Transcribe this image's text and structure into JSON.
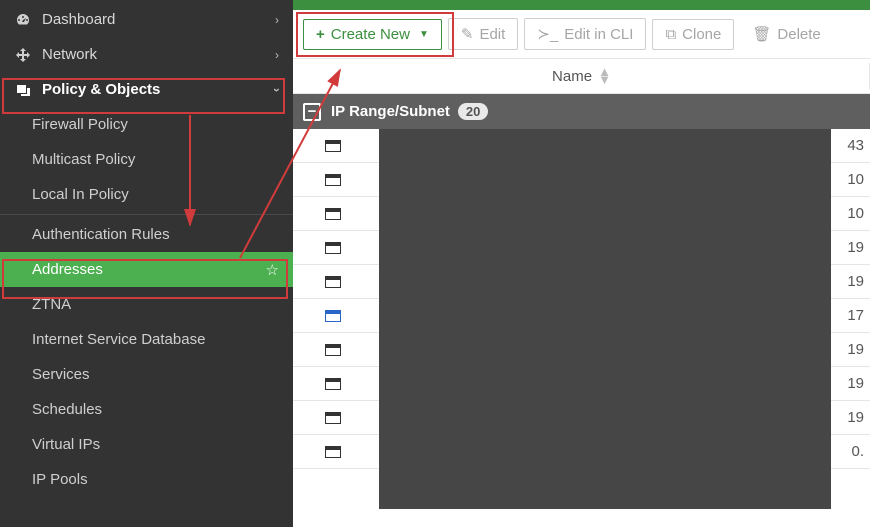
{
  "sidebar": {
    "items": [
      {
        "label": "Dashboard",
        "icon": "dashboard-icon"
      },
      {
        "label": "Network",
        "icon": "network-icon"
      },
      {
        "label": "Policy & Objects",
        "icon": "policy-icon"
      }
    ],
    "sub_items": [
      {
        "label": "Firewall Policy"
      },
      {
        "label": "Multicast Policy"
      },
      {
        "label": "Local In Policy"
      },
      {
        "label": "Authentication Rules"
      },
      {
        "label": "Addresses"
      },
      {
        "label": "ZTNA"
      },
      {
        "label": "Internet Service Database"
      },
      {
        "label": "Services"
      },
      {
        "label": "Schedules"
      },
      {
        "label": "Virtual IPs"
      },
      {
        "label": "IP Pools"
      }
    ]
  },
  "toolbar": {
    "create": "Create New",
    "edit": "Edit",
    "edit_cli": "Edit in CLI",
    "clone": "Clone",
    "delete": "Delete"
  },
  "table": {
    "column_name": "Name",
    "group_label": "IP Range/Subnet",
    "group_count": "20",
    "rows": [
      {
        "val": "43"
      },
      {
        "val": "10"
      },
      {
        "val": "10"
      },
      {
        "val": "19"
      },
      {
        "val": "19"
      },
      {
        "val": "17"
      },
      {
        "val": "19"
      },
      {
        "val": "19"
      },
      {
        "val": "19"
      },
      {
        "val": "0."
      }
    ]
  }
}
